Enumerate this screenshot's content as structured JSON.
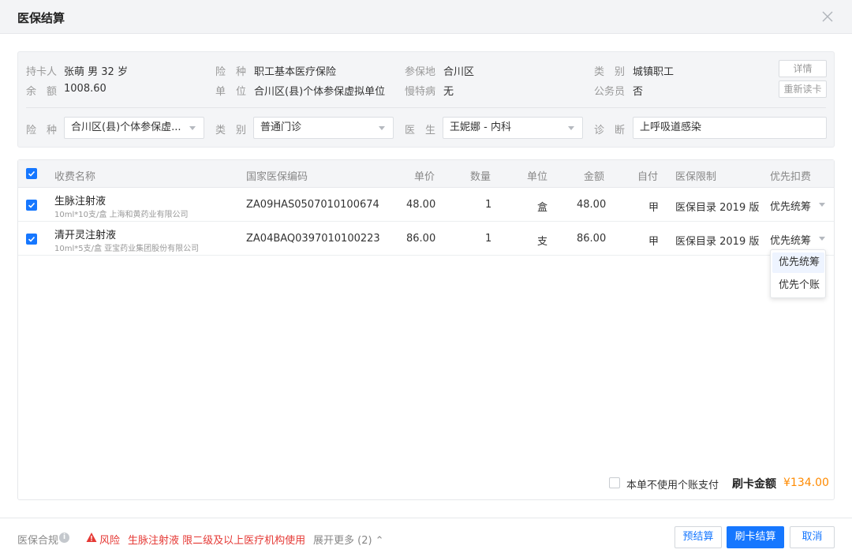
{
  "dialog": {
    "title": "医保结算"
  },
  "info": {
    "cardholder_label": "持卡人",
    "cardholder_value": "张萌 男 32 岁",
    "insurance_label": "险　种",
    "insurance_value": "职工基本医疗保险",
    "region_label": "参保地",
    "region_value": "合川区",
    "category_label": "类　别",
    "category_value": "城镇职工",
    "balance_label": "余　额",
    "balance_value": "1008.60",
    "unit_label": "单　位",
    "unit_value": "合川区(县)个体参保虚拟单位",
    "chronic_label": "慢特病",
    "chronic_value": "无",
    "civil_label": "公务员",
    "civil_value": "否",
    "details_button": "详情",
    "reread_button": "重新读卡"
  },
  "form": {
    "insurance_label": "险　种",
    "insurance_value": "合川区(县)个体参保虚...",
    "category_label": "类　别",
    "category_value": "普通门诊",
    "doctor_label": "医　生",
    "doctor_value": "王妮娜 - 内科",
    "diagnosis_label": "诊　断",
    "diagnosis_value": "上呼吸道感染"
  },
  "table": {
    "headers": [
      "收费名称",
      "国家医保编码",
      "单价",
      "数量",
      "单位",
      "金额",
      "自付",
      "医保限制",
      "优先扣费"
    ],
    "rows": [
      {
        "name": "生脉注射液",
        "spec": "10ml*10支/盒 上海和黄药业有限公司",
        "code": "ZA09HAS0507010100674",
        "price": "48.00",
        "qty": "1",
        "unit": "盒",
        "amount": "48.00",
        "self_pay": "甲",
        "limit": "医保目录 2019 版",
        "priority": "优先统筹"
      },
      {
        "name": "清开灵注射液",
        "spec": "10ml*5支/盒 亚宝药业集团股份有限公司",
        "code": "ZA04BAQ0397010100223",
        "price": "86.00",
        "qty": "1",
        "unit": "支",
        "amount": "86.00",
        "self_pay": "甲",
        "limit": "医保目录 2019 版",
        "priority": "优先统筹"
      }
    ],
    "dropdown_options": [
      "优先统筹",
      "优先个账"
    ]
  },
  "summary": {
    "no_personal_account_label": "本单不使用个账支付",
    "card_amount_label": "刷卡金额",
    "card_amount_value": "¥134.00"
  },
  "footer": {
    "compliance_label": "医保合规",
    "risk_label": "风险",
    "risk_message": "生脉注射液 限二级及以上医疗机构使用",
    "expand_more": "展开更多 (2) ⌃",
    "pre_settle_button": "预结算",
    "card_settle_button": "刷卡结算",
    "cancel_button": "取消"
  },
  "colors": {
    "primary": "#1677ff",
    "risk": "#e53935",
    "amount": "#ff8a00"
  }
}
